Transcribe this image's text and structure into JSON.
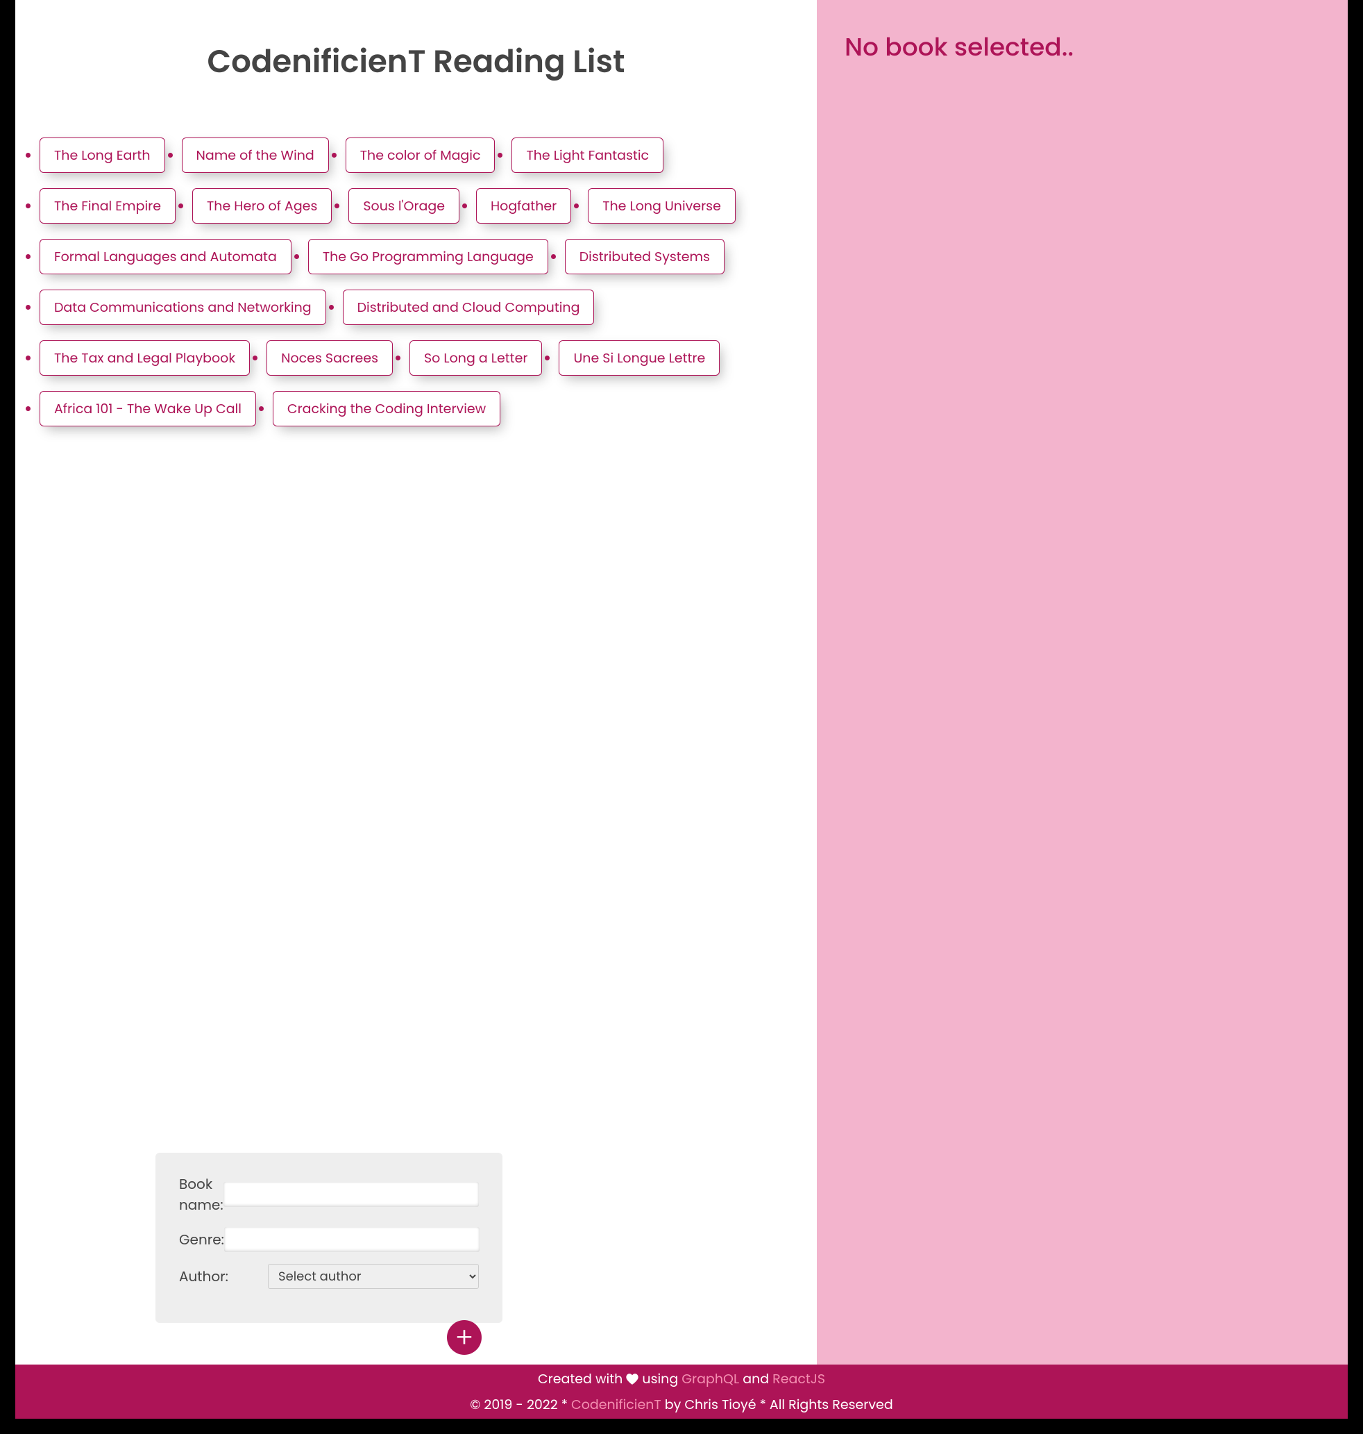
{
  "title": "CodenificienT Reading List",
  "books": [
    "The Long Earth",
    "Name of the Wind",
    "The color of Magic",
    "The Light Fantastic",
    "The Final Empire",
    "The Hero of Ages",
    "Sous l'Orage",
    "Hogfather",
    "The Long Universe",
    "Formal Languages and Automata",
    "The Go Programming Language",
    "Distributed Systems",
    "Data Communications and Networking",
    "Distributed and Cloud Computing",
    "The Tax and Legal Playbook",
    "Noces Sacrees",
    "So Long a Letter",
    "Une Si Longue Lettre",
    "Africa 101 - The Wake Up Call",
    "Cracking the Coding Interview"
  ],
  "form": {
    "book_label": "Book name:",
    "genre_label": "Genre:",
    "author_label": "Author:",
    "book_value": "",
    "genre_value": "",
    "author_placeholder": "Select author",
    "add_symbol": "+"
  },
  "side": {
    "empty_msg": "No book selected.."
  },
  "footer": {
    "created_prefix": "Created with ",
    "using_text": " using ",
    "graphql": "GraphQL",
    "and_text": " and ",
    "reactjs": "ReactJS",
    "copyright_prefix": "© 2019 - 2022 * ",
    "brand": "CodenificienT",
    "copyright_suffix": " by Chris Tioyé * All Rights Reserved"
  }
}
